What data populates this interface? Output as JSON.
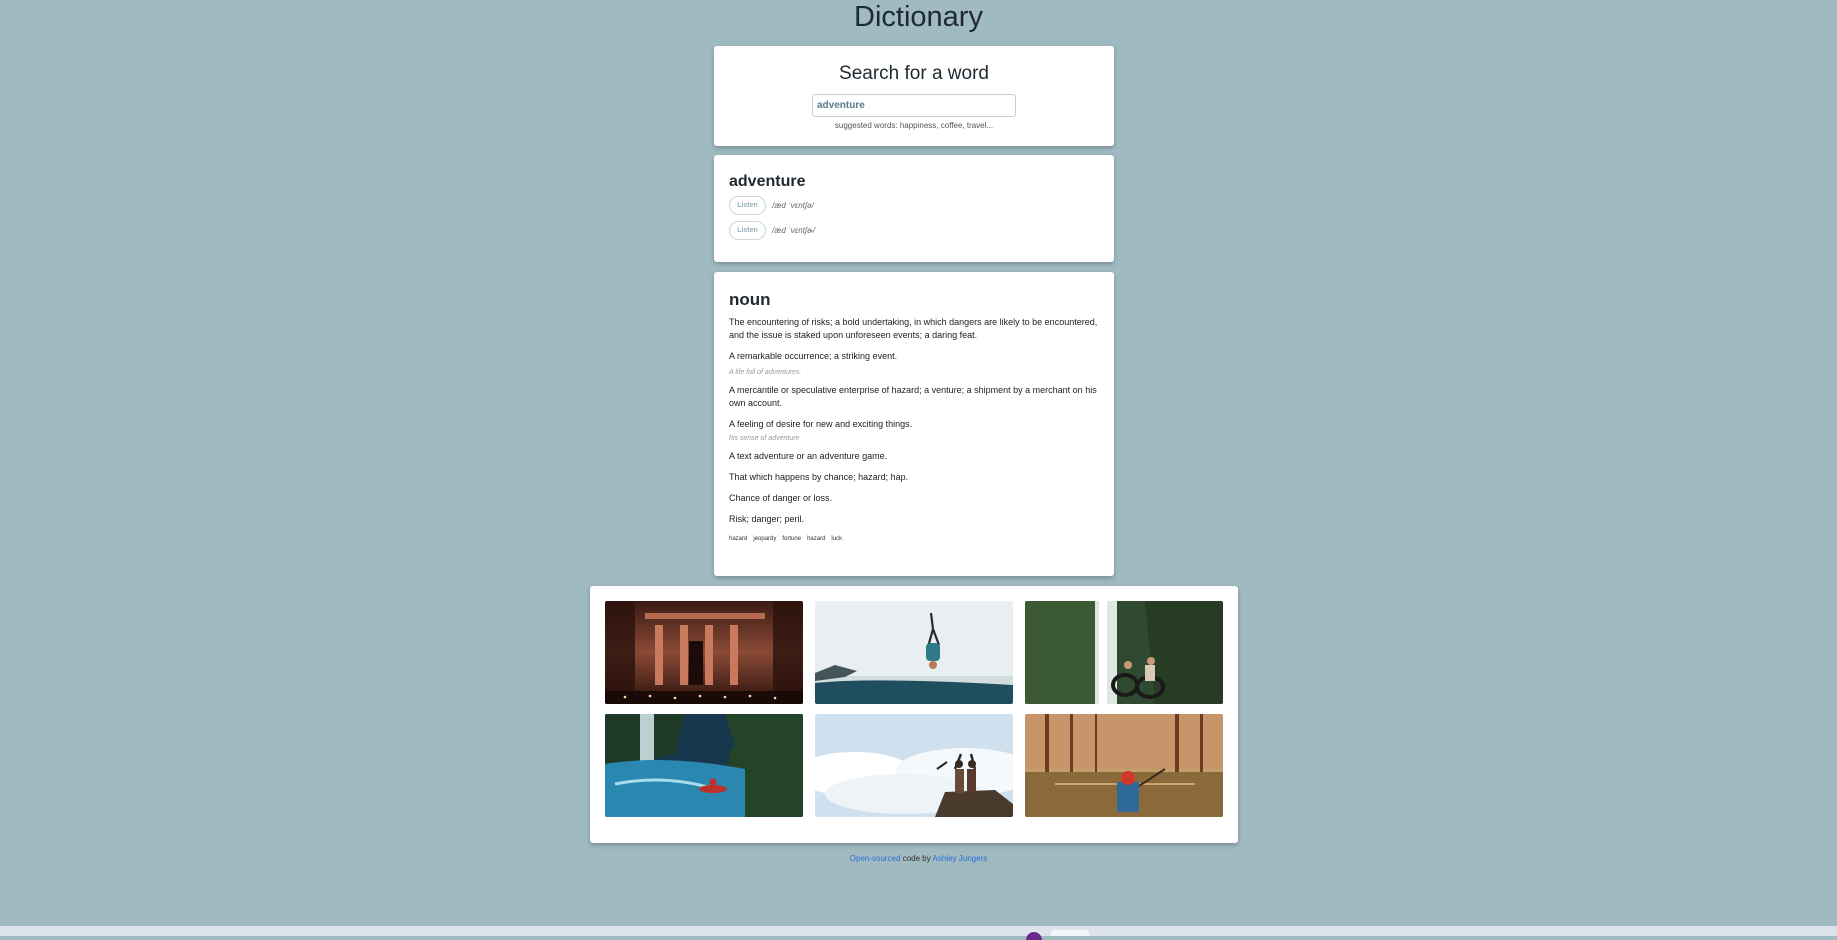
{
  "app": {
    "title": "Dictionary"
  },
  "search": {
    "heading": "Search for a word",
    "value": "adventure",
    "hint": "suggested words: happiness, coffee, travel..."
  },
  "word": {
    "text": "adventure",
    "phonetics": [
      {
        "button": "Listen",
        "text": "/æd ˈvɛntʃə/"
      },
      {
        "button": "Listen",
        "text": "/æd ˈvɛntʃɚ/"
      }
    ]
  },
  "meaning": {
    "part_of_speech": "noun",
    "definitions": [
      {
        "text": "The encountering of risks; a bold undertaking, in which dangers are likely to be encountered, and the issue is staked upon unforeseen events; a daring feat.",
        "example": ""
      },
      {
        "text": "A remarkable occurrence; a striking event.",
        "example": "A life full of adventures."
      },
      {
        "text": "A mercantile or speculative enterprise of hazard; a venture; a shipment by a merchant on his own account.",
        "example": ""
      },
      {
        "text": "A feeling of desire for new and exciting things.",
        "example": "his sense of adventure"
      },
      {
        "text": "A text adventure or an adventure game.",
        "example": ""
      },
      {
        "text": "That which happens by chance; hazard; hap.",
        "example": ""
      },
      {
        "text": "Chance of danger or loss.",
        "example": ""
      },
      {
        "text": "Risk; danger; peril.",
        "example": ""
      }
    ],
    "synonyms": [
      "hazard",
      "jeopardy",
      "fortune",
      "hazard",
      "luck"
    ]
  },
  "photos": [
    {
      "icon": "petra-treasury-photo"
    },
    {
      "icon": "cliff-dive-photo"
    },
    {
      "icon": "waterfall-tubing-photo"
    },
    {
      "icon": "kayak-river-photo"
    },
    {
      "icon": "mountain-summit-photo"
    },
    {
      "icon": "swamp-canoe-photo"
    }
  ],
  "footer": {
    "link1": "Open-sourced",
    "middle": "code by",
    "link2": "Ashley Jungers"
  },
  "colors": {
    "background": "#a0bac2",
    "link": "#2b6fd6",
    "card": "#ffffff"
  }
}
